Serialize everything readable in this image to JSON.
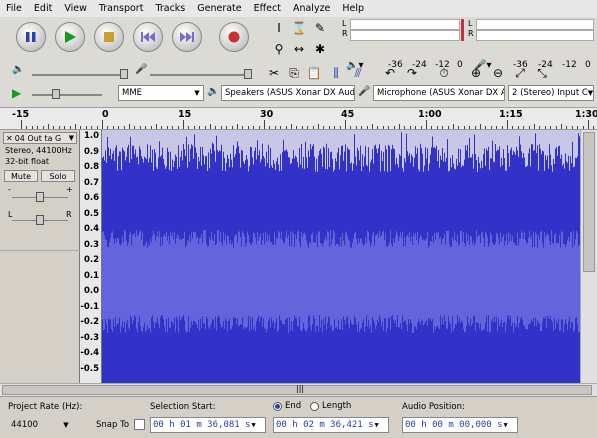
{
  "menu": [
    "File",
    "Edit",
    "View",
    "Transport",
    "Tracks",
    "Generate",
    "Effect",
    "Analyze",
    "Help"
  ],
  "meters": {
    "left_letter": "L",
    "right_letter": "R",
    "play_scale": [
      "-36",
      "-24",
      "-12",
      "0"
    ],
    "rec_scale": [
      "-36",
      "-24",
      "-12",
      "0"
    ]
  },
  "device": {
    "host": "MME",
    "output": "Speakers (ASUS Xonar DX Aud",
    "input": "Microphone (ASUS Xonar DX A",
    "channels": "2 (Stereo) Input C"
  },
  "ruler": {
    "labels": [
      {
        "text": "-15",
        "value": -15
      },
      {
        "text": "0",
        "value": 0
      },
      {
        "text": "15",
        "value": 15
      },
      {
        "text": "30",
        "value": 30
      },
      {
        "text": "45",
        "value": 45
      },
      {
        "text": "1:00",
        "value": 60
      },
      {
        "text": "1:15",
        "value": 75
      },
      {
        "text": "1:30",
        "value": 90
      }
    ]
  },
  "track": {
    "name": "04 Out ta G",
    "format": "Stereo, 44100Hz",
    "bits": "32-bit float",
    "mute": "Mute",
    "solo": "Solo",
    "gain_minus": "-",
    "gain_plus": "+",
    "pan_left": "L",
    "pan_right": "R"
  },
  "vscale": [
    "1.0",
    "0.9",
    "0.8",
    "0.7",
    "0.6",
    "0.5",
    "0.4",
    "0.3",
    "0.2",
    "0.1",
    "0.0",
    "-0.1",
    "-0.2",
    "-0.3",
    "-0.4",
    "-0.5"
  ],
  "selection": {
    "rate_label": "Project Rate (Hz):",
    "rate_value": "44100",
    "snap_label": "Snap To",
    "start_label": "Selection Start:",
    "end_label": "End",
    "length_label": "Length",
    "audio_pos_label": "Audio Position:",
    "start_value": "00 h 01 m 36,081 s",
    "end_value": "00 h 02 m 36,421 s",
    "audio_pos_value": "00 h 00 m 00,000 s"
  },
  "colors": {
    "wave_dark": "#3232c8",
    "wave_light": "#6464dc",
    "clip": "#c8c8e6"
  }
}
